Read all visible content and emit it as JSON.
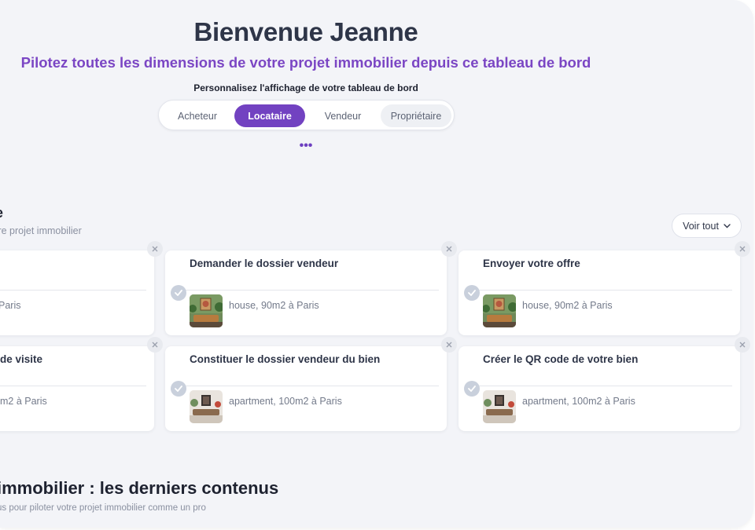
{
  "header": {
    "title": "Bienvenue Jeanne",
    "subtitle": "Pilotez toutes les dimensions de votre projet immobilier depuis ce tableau de bord",
    "customize_label": "Personnalisez l'affichage de votre tableau de bord"
  },
  "profile_tabs": [
    {
      "label": "Acheteur",
      "state": "default"
    },
    {
      "label": "Locataire",
      "state": "selected"
    },
    {
      "label": "Vendeur",
      "state": "default"
    },
    {
      "label": "Propriétaire",
      "state": "highlighted"
    }
  ],
  "more_icon": "ellipsis-icon",
  "tasks_section": {
    "title": "e",
    "subtitle": "tre projet immobilier",
    "see_all_label": "Voir tout",
    "cards": [
      {
        "title": "",
        "location": "Paris",
        "image": "house-thumbnail"
      },
      {
        "title": "Demander le dossier vendeur",
        "location": "house, 90m2 à Paris",
        "image": "house-thumbnail"
      },
      {
        "title": "Envoyer votre offre",
        "location": "house, 90m2 à Paris",
        "image": "house-thumbnail"
      },
      {
        "title": "de visite",
        "location": "m2 à Paris",
        "image": "apartment-thumbnail"
      },
      {
        "title": "Constituer le dossier vendeur du bien",
        "location": "apartment, 100m2 à Paris",
        "image": "apartment-thumbnail"
      },
      {
        "title": "Créer le QR code de votre bien",
        "location": "apartment, 100m2 à Paris",
        "image": "apartment-thumbnail"
      }
    ]
  },
  "content_section": {
    "title": "immobilier : les derniers contenus",
    "subtitle": "us pour piloter votre projet immobilier comme un pro"
  },
  "colors": {
    "accent": "#7242c1",
    "subtitle": "#7b46c4",
    "background": "#f3f4f8",
    "card": "#ffffff"
  }
}
